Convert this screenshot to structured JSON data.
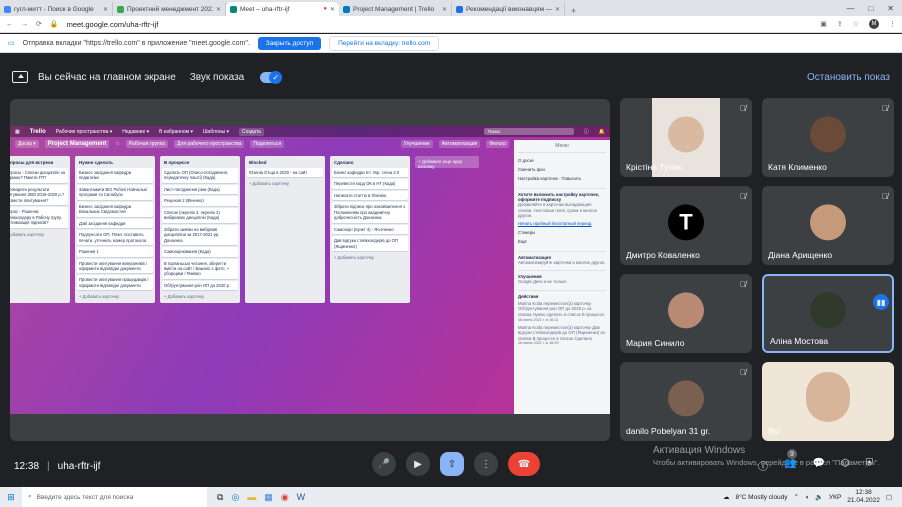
{
  "browser": {
    "tabs": [
      {
        "label": "гугл-митт - Поиск в Google",
        "color": "#4285f4"
      },
      {
        "label": "Проектний менеджмент 2021-2...",
        "color": "#34a853"
      },
      {
        "label": "Meet – uha-rftr-ijf",
        "color": "#00897b"
      },
      {
        "label": "Project Management | Trello",
        "color": "#0079bf"
      },
      {
        "label": "Рекомендації виконавцям — Но...",
        "color": "#1a73e8"
      }
    ],
    "url": "meet.google.com/uha-rftr-ijf",
    "profile": "M",
    "window_controls": [
      "—",
      "□",
      "✕"
    ]
  },
  "infobar": {
    "text": "Отправка вкладки \"https://trello.com\" в приложение \"meet.google.com\".",
    "stop_label": "Закрыть доступ",
    "switch_label": "Перейти на вкладку: trello.com"
  },
  "meet": {
    "presenting_text": "Вы сейчас на главном экране",
    "sound_label": "Звук показа",
    "stop_label": "Остановить показ",
    "time": "12:38",
    "meeting_code": "uha-rftr-ijf",
    "people_count": "9"
  },
  "trello": {
    "logo": "Trello",
    "nav": [
      "Рабочие пространства ▾",
      "Недавние ▾",
      "В избранном ▾",
      "Шаблоны ▾",
      "Создать"
    ],
    "search": "Поиск",
    "board_name": "Project Management",
    "board_chips": [
      "Доска ▾",
      "Рабочая группа",
      "Для рабочего пространства",
      "Поделиться"
    ],
    "board_right": [
      "Улучшение",
      "Автоматизация",
      "Фильтр"
    ],
    "lists": [
      {
        "title": "Вопросы для встречи",
        "cards": [
          "Вопросы - Списки дисциплін за формою? Пакети ГП?",
          "Обговорити результати опитування ЗВО 2019-2020 р.? Провести опитування?",
          "Вопрос - Рішення. Стейкхолдеру в Рабочу групу. Легітимізація підписів?"
        ],
        "add": "+ Добавить карточку"
      },
      {
        "title": "Нужно сделать",
        "cards": [
          "Бизнес засідання кафедри педагогіки",
          "Завантажити ВСІ Робочі Навчальні програми та Силабуси",
          "Бизнес засідання кафедри Вокальних Свідомостей",
          "Дзві засідання кафедри",
          "Подпунсати ОП. План: поставить печати, уточнить номер протокола",
          "Рішення 1",
          "Провести опитування випускників і оформити відповідні документи",
          "Провести опитування працедавців і оформити відповідні документи"
        ],
        "add": "+ Добавить карточку"
      },
      {
        "title": "В процессе",
        "cards": [
          "Сделать ОП (Описо-погодження, передаточну пошті) (Када)",
          "Лист-погодження ріни (Када)",
          "Рецензія 2 (Фіненко)",
          "Список (перелік 3. перелік 2) вибіркових дисциплін (Када)",
          "Зібрати заявки на вибіркові дисципліни за 2017-2021 рр. Донаєнка",
          "Самооцінювання (Када)",
          "В Іорланьські читання, зберегти вмісти на сайт / Бажано з фото, + уборщики / Яневко",
          "Обґрунтування рон ОП до 2020 р."
        ],
        "add": "+ Добавить карточку"
      },
      {
        "title": "Blocked",
        "cards": [
          "Юзеніа Отща в 2020 - на сайт"
        ],
        "add": "+ Добавить карточку"
      },
      {
        "title": "Сделано",
        "cards": [
          "Бізнес кафедри Іст. Укр. сгена 2.0",
          "Перевести корд ОК в НТ (Када)",
          "Написати статтю в Юзенію",
          "Зібрати підписи про ознайомлення з Положенням про академічну доброчесність Донаєнка",
          "Самооцін (пункт 4) - Ясніченко",
          "Дав відгуки стейкхолдерів до ОП (Ящиненко)"
        ],
        "add": "+ Добавить карточку"
      }
    ],
    "add_list": "+ Добавьте еще одну колонку",
    "menu": {
      "title": "Меню",
      "items": [
        "О доске",
        "Сменить фон",
        "Настройка карточек · Повысить"
      ],
      "promo": "Хотите включить настройку карточек, оформите подписку",
      "promo_sub": "Добавляйте в карточки выпадающие списки, текстовые поля, сроки и многое другое.",
      "promo_link": "Начать пробный бесплатный период",
      "items2": [
        "Стикеры",
        "Ещё"
      ],
      "automation": "Автоматизация",
      "automation_sub": "Автоматизируйте карточки и многие другое.",
      "improvements": "Улучшения",
      "improvements_sub": "Google Диск и не только",
      "actions": "Действия",
      "activity": [
        "Marina Koda переместил(а) карточку Обґрунтування рон ОП до 2020 р. из списка Нужно сделать в список В процессе",
        "Marina Koda переместил(а) карточку Дав відгуки стейкхолдерів до ОП (Ящиненко) из списка В процессе в список Сделано"
      ],
      "dates": [
        "16 июня 2021 г. в 16:11",
        "16 июня 2021 г. в 16:09"
      ]
    }
  },
  "participants": [
    {
      "name": "Крістіна Тупик",
      "face_color": "#d9b9a0",
      "bg": "#e8e3dd"
    },
    {
      "name": "Катя Клименко",
      "face_color": "#6b4a3a",
      "bg": "#3c4043"
    },
    {
      "name": "Дмитро Коваленко",
      "face_color": "#000000",
      "bg": "#3c4043",
      "initial": "T"
    },
    {
      "name": "Діана Арищенко",
      "face_color": "#c49a7a",
      "bg": "#3c4043"
    },
    {
      "name": "Мария Синило",
      "face_color": "#b88a73",
      "bg": "#3c4043"
    },
    {
      "name": "Аліна Мостова",
      "face_color": "#2f3a2a",
      "bg": "#3c4043"
    },
    {
      "name": "danilo Pobelyan 31 gr.",
      "face_color": "#7a6050",
      "bg": "#3c4043"
    },
    {
      "name": "Вы",
      "face_color": "#d7b49a",
      "bg": "#efe6d8"
    }
  ],
  "watermark": {
    "title": "Активация Windows",
    "sub": "Чтобы активировать Windows, перейдите в раздел \"Параметры\"."
  },
  "taskbar": {
    "search": "Введите здесь текст для поиска",
    "weather": "8°C Mostly cloudy",
    "lang": "УКР",
    "time": "12:38",
    "date": "21.04.2022"
  }
}
